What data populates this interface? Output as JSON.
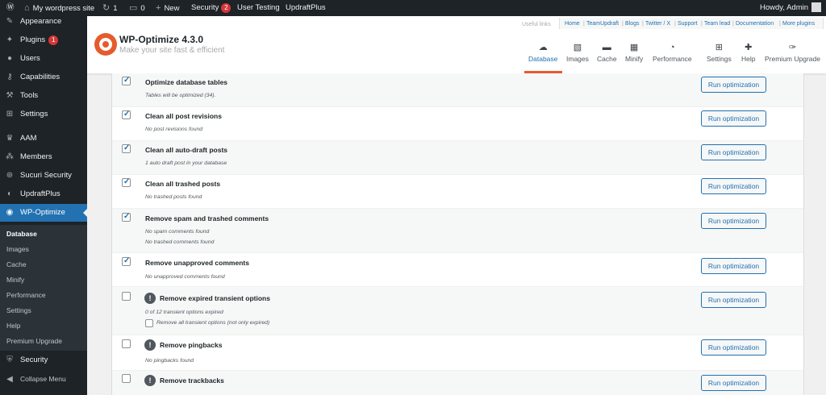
{
  "admin_bar": {
    "site_name": "My wordpress site",
    "updates_count": "1",
    "comments_count": "0",
    "new_label": "New",
    "security_label": "Security",
    "security_count": "2",
    "user_testing_label": "User Testing",
    "updraftplus_label": "UpdraftPlus",
    "howdy": "Howdy, Admin"
  },
  "sidebar": {
    "items": [
      {
        "label": "Appearance",
        "icon": "paintbrush-icon"
      },
      {
        "label": "Plugins",
        "icon": "plugin-icon",
        "badge": "1"
      },
      {
        "label": "Users",
        "icon": "users-icon"
      },
      {
        "label": "Capabilities",
        "icon": "key-icon"
      },
      {
        "label": "Tools",
        "icon": "wrench-icon"
      },
      {
        "label": "Settings",
        "icon": "settings-icon"
      },
      {
        "label": "AAM",
        "icon": "aam-icon"
      },
      {
        "label": "Members",
        "icon": "members-icon"
      },
      {
        "label": "Sucuri Security",
        "icon": "sucuri-icon"
      },
      {
        "label": "UpdraftPlus",
        "icon": "updraftplus-icon"
      },
      {
        "label": "WP-Optimize",
        "icon": "wp-optimize-icon"
      },
      {
        "label": "Security",
        "icon": "shield-icon"
      },
      {
        "label": "Collapse Menu",
        "icon": "collapse-icon"
      }
    ],
    "submenu": [
      "Database",
      "Images",
      "Cache",
      "Minify",
      "Performance",
      "Settings",
      "Help",
      "Premium Upgrade"
    ]
  },
  "header": {
    "title": "WP-Optimize 4.3.0",
    "tagline": "Make your site fast & efficient",
    "useful_links_label": "Useful links",
    "links": [
      "Home",
      "TeamUpdraft",
      "Blogs",
      "Twitter / X",
      "Support",
      "Team lead",
      "Documentation",
      "More plugins"
    ],
    "tabs": [
      {
        "label": "Database",
        "icon": "cloud-icon"
      },
      {
        "label": "Images",
        "icon": "images-icon"
      },
      {
        "label": "Cache",
        "icon": "cache-icon"
      },
      {
        "label": "Minify",
        "icon": "minify-icon"
      },
      {
        "label": "Performance",
        "icon": "dashboard-icon"
      },
      {
        "label": "Settings",
        "icon": "settings-icon"
      },
      {
        "label": "Help",
        "icon": "help-icon"
      },
      {
        "label": "Premium Upgrade",
        "icon": "premium-icon"
      }
    ]
  },
  "optimizations": {
    "button_label": "Run optimization",
    "rows": [
      {
        "title": "Optimize database tables",
        "checked": true,
        "details": [
          "Tables will be optimized (34)."
        ]
      },
      {
        "title": "Clean all post revisions",
        "checked": true,
        "details": [
          "No post revisions found"
        ]
      },
      {
        "title": "Clean all auto-draft posts",
        "checked": true,
        "details": [
          "1 auto draft post in your database"
        ]
      },
      {
        "title": "Clean all trashed posts",
        "checked": true,
        "details": [
          "No trashed posts found"
        ]
      },
      {
        "title": "Remove spam and trashed comments",
        "checked": true,
        "details": [
          "No spam comments found",
          "No trashed comments found"
        ]
      },
      {
        "title": "Remove unapproved comments",
        "checked": true,
        "details": [
          "No unapproved comments found"
        ]
      },
      {
        "title": "Remove expired transient options",
        "checked": false,
        "warning": true,
        "details": [
          "0 of 12 transient options expired"
        ],
        "extra_option": "Remove all transient options (not only expired)"
      },
      {
        "title": "Remove pingbacks",
        "checked": false,
        "warning": true,
        "details": [
          "No pingbacks found"
        ]
      },
      {
        "title": "Remove trackbacks",
        "checked": false,
        "warning": true,
        "details": []
      }
    ]
  },
  "colors": {
    "admin_dark": "#1d2327",
    "wp_blue": "#2271b1",
    "wpo_orange": "#e65a2c",
    "badge_red": "#d63638"
  }
}
